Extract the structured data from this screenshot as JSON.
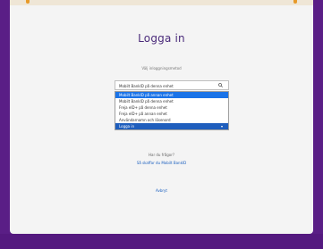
{
  "header": {
    "title": "Logga in"
  },
  "form": {
    "label": "Välj inloggningsmetod",
    "select": {
      "value": "Mobilt BankID på denna enhet",
      "options": [
        {
          "label": "Mobilt BankID på annan enhet"
        },
        {
          "label": "Mobilt BankID på denna enhet"
        },
        {
          "label": "Freja eID+ på denna enhet"
        },
        {
          "label": "Freja eID+ på annan enhet"
        },
        {
          "label": "Användarnamn och lösenord"
        }
      ],
      "footer": "Logga in"
    }
  },
  "help": {
    "text": "Har du frågor?",
    "link_bankid": "Så skaffar du Mobilt BankID"
  },
  "navigation": {
    "back": "Avbryt"
  },
  "colors": {
    "brand": "#5a1e86",
    "accent": "#1a73e8",
    "title": "#4a2a7a"
  }
}
